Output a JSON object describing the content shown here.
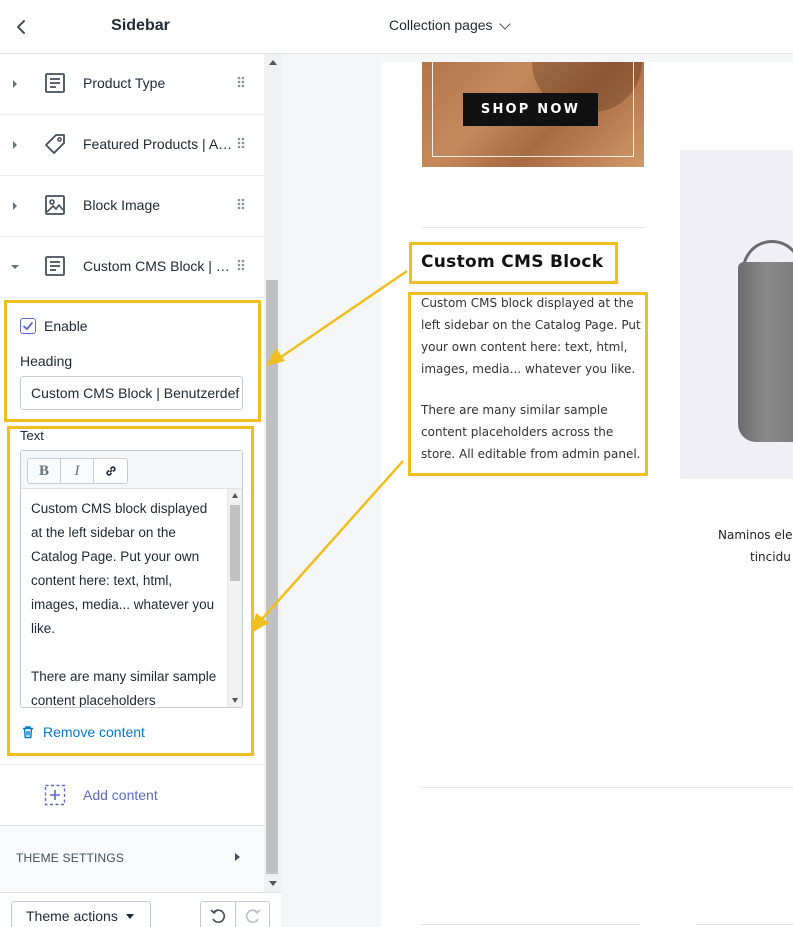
{
  "sidebar": {
    "title": "Sidebar",
    "sections": [
      {
        "label": "Product Type",
        "icon": "text-block-icon"
      },
      {
        "label": "Featured Products | Au...",
        "icon": "tag-icon"
      },
      {
        "label": "Block Image",
        "icon": "image-icon"
      },
      {
        "label": "Custom CMS Block | B...",
        "icon": "text-block-icon",
        "expanded": true
      }
    ],
    "settings": {
      "enable_label": "Enable",
      "enable_checked": true,
      "heading_label": "Heading",
      "heading_value": "Custom CMS Block | Benutzerdef",
      "text_label": "Text",
      "editor": {
        "bold_label": "B",
        "italic_label": "I",
        "paragraph1": "Custom CMS block displayed at the left sidebar on the Catalog Page. Put your own content here: text, html, images, media... whatever you like.",
        "paragraph2": "There are many similar sample content placeholders"
      },
      "remove_label": "Remove content"
    },
    "add_content_label": "Add content",
    "theme_settings_label": "THEME SETTINGS",
    "footer": {
      "theme_actions_label": "Theme actions"
    }
  },
  "preview": {
    "page_selector": "Collection pages",
    "banner_button": "SHOP NOW",
    "cms_block": {
      "title": "Custom CMS Block",
      "paragraph1": "Custom CMS block displayed at the left sidebar on the Catalog Page. Put your own content here: text, html, images, media... whatever you like.",
      "paragraph2": "There are many similar sample content placeholders across the store. All editable from admin panel."
    },
    "product_text_line1": "Naminos ele",
    "product_text_line2": "tincidu"
  },
  "colors": {
    "annotation": "#f0be1e",
    "accent_link": "#007ace",
    "accent_indigo": "#5c6ac4"
  }
}
